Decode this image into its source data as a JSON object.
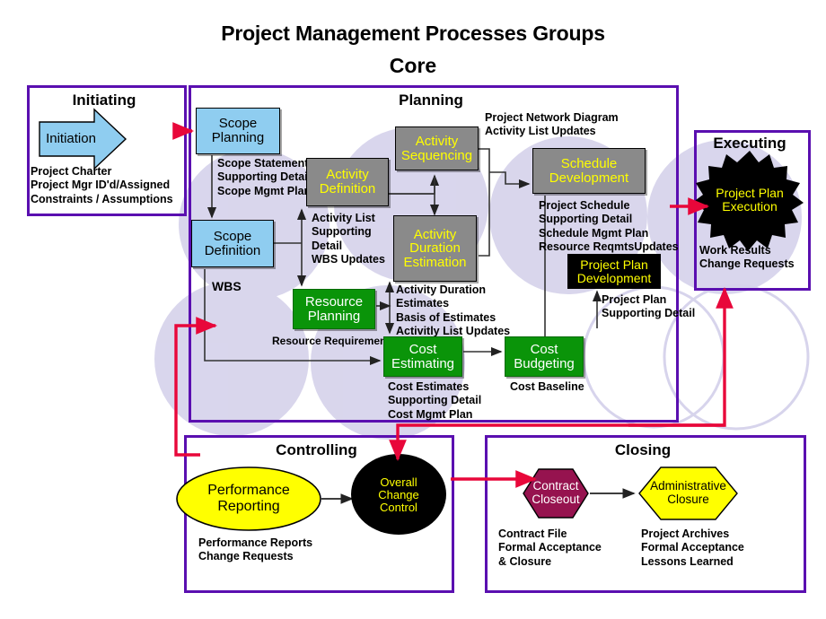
{
  "title": {
    "main": "Project Management Processes Groups",
    "sub": "Core"
  },
  "groups": {
    "initiating": {
      "label": "Initiating"
    },
    "planning": {
      "label": "Planning"
    },
    "executing": {
      "label": "Executing"
    },
    "controlling": {
      "label": "Controlling"
    },
    "closing": {
      "label": "Closing"
    }
  },
  "initiating": {
    "process": "Initiation",
    "outputs": [
      "Project Charter",
      "Project Mgr ID'd/Assigned",
      "Constraints / Assumptions"
    ]
  },
  "planning": {
    "scope_planning": {
      "line1": "Scope",
      "line2": "Planning"
    },
    "scope_planning_outputs": [
      "Scope Statement",
      "Supporting Detail",
      "Scope Mgmt Plan"
    ],
    "scope_definition": {
      "line1": "Scope",
      "line2": "Definition"
    },
    "scope_definition_output": "WBS",
    "activity_definition": {
      "line1": "Activity",
      "line2": "Definition"
    },
    "activity_definition_outputs": [
      "Activity List",
      "Supporting",
      "Detail",
      "WBS Updates"
    ],
    "activity_sequencing": {
      "line1": "Activity",
      "line2": "Sequencing"
    },
    "activity_sequencing_outputs": [
      "Project Network Diagram",
      "Activity List Updates"
    ],
    "activity_duration_estimation": {
      "line1": "Activity",
      "line2": "Duration",
      "line3": "Estimation"
    },
    "activity_duration_outputs": [
      "Activity Duration",
      "Estimates",
      "Basis of Estimates",
      "Activitly List Updates"
    ],
    "resource_planning": {
      "line1": "Resource",
      "line2": "Planning"
    },
    "resource_planning_output": "Resource Requirements",
    "cost_estimating": {
      "line1": "Cost",
      "line2": "Estimating"
    },
    "cost_estimating_outputs": [
      "Cost Estimates",
      "Supporting Detail",
      "Cost Mgmt Plan"
    ],
    "cost_budgeting": {
      "line1": "Cost",
      "line2": "Budgeting"
    },
    "cost_budgeting_output": "Cost Baseline",
    "schedule_development": {
      "line1": "Schedule",
      "line2": "Development"
    },
    "schedule_development_outputs": [
      "Project Schedule",
      "Supporting Detail",
      "Schedule Mgmt Plan",
      "Resource ReqmtsUpdates"
    ],
    "project_plan_development": {
      "line1": "Project Plan",
      "line2": "Development"
    },
    "project_plan_development_inputs": [
      "Project Plan",
      "Supporting Detail"
    ]
  },
  "executing": {
    "process": {
      "line1": "Project",
      "line2": "Plan",
      "line3": "Execution"
    },
    "outputs": [
      "Work Results",
      "Change Requests"
    ]
  },
  "controlling": {
    "performance_reporting": {
      "line1": "Performance",
      "line2": "Reporting"
    },
    "performance_reporting_outputs": [
      "Performance Reports",
      "Change Requests"
    ],
    "overall_change_control": {
      "line1": "Overall",
      "line2": "Change",
      "line3": "Control"
    }
  },
  "closing": {
    "contract_closeout": {
      "line1": "Contract",
      "line2": "Closeout"
    },
    "contract_closeout_outputs": [
      "Contract File",
      "Formal Acceptance",
      " & Closure"
    ],
    "administrative_closure": {
      "line1": "Administrative",
      "line2": "Closure"
    },
    "administrative_closure_outputs": [
      "Project Archives",
      "Formal Acceptance",
      "Lessons Learned"
    ]
  },
  "colors": {
    "group_border": "#5a0fb0",
    "blue_node": "#8fcdf0",
    "gray_node": "#8a8a8a",
    "green_node": "#0a9409",
    "black_node": "#000000",
    "yellow_node": "#ffff00",
    "maroon_node": "#96134f",
    "accent_red": "#e8073a",
    "halo": "#d7d4ec"
  }
}
